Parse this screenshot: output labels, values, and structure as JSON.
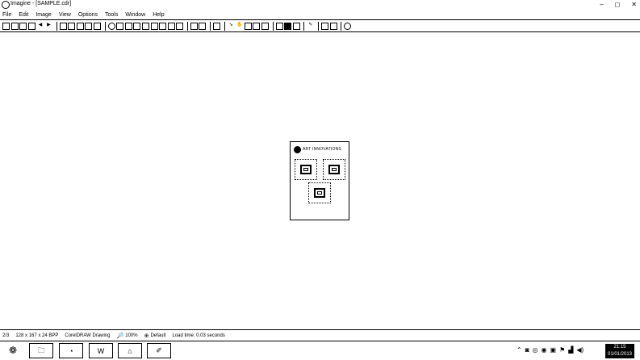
{
  "window": {
    "title": "Imagine - [SAMPLE.cdr]",
    "controls": [
      "–",
      "◻",
      "✕"
    ]
  },
  "menu": [
    "File",
    "Edit",
    "Image",
    "View",
    "Options",
    "Tools",
    "Window",
    "Help"
  ],
  "document": {
    "header_text": "ART INNOVATIONS"
  },
  "status": {
    "position": "2/3",
    "dimensions": "128 x 167 x 24 BPP",
    "format": "CorelDRAW Drawing",
    "zoom": "100%",
    "profile": "Default",
    "load_time": "Load time: 0.03 seconds"
  },
  "taskbar": {
    "clock_time": "21:15",
    "clock_date": "01/01/2013"
  }
}
